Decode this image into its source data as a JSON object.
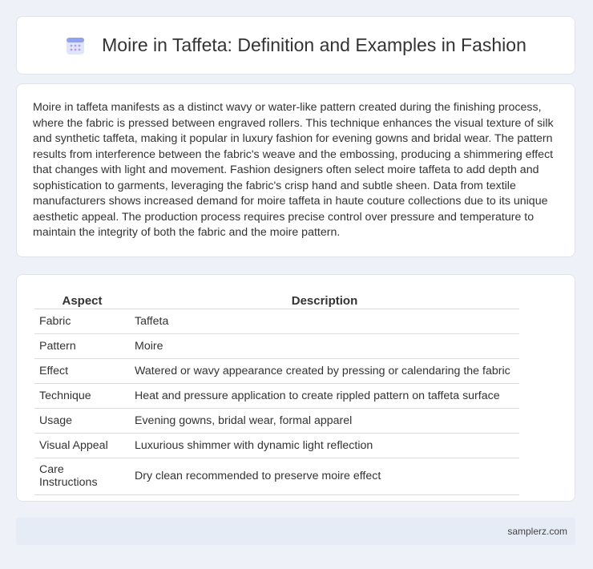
{
  "header": {
    "title": "Moire in Taffeta: Definition and Examples in Fashion",
    "icon": "calendar-icon"
  },
  "intro": {
    "text": "Moire in taffeta manifests as a distinct wavy or water-like pattern created during the finishing process, where the fabric is pressed between engraved rollers. This technique enhances the visual texture of silk and synthetic taffeta, making it popular in luxury fashion for evening gowns and bridal wear. The pattern results from interference between the fabric's weave and the embossing, producing a shimmering effect that changes with light and movement. Fashion designers often select moire taffeta to add depth and sophistication to garments, leveraging the fabric's crisp hand and subtle sheen. Data from textile manufacturers shows increased demand for moire taffeta in haute couture collections due to its unique aesthetic appeal. The production process requires precise control over pressure and temperature to maintain the integrity of both the fabric and the moire pattern."
  },
  "table": {
    "headers": [
      "Aspect",
      "Description"
    ],
    "rows": [
      [
        "Fabric",
        "Taffeta"
      ],
      [
        "Pattern",
        "Moire"
      ],
      [
        "Effect",
        "Watered or wavy appearance created by pressing or calendaring the fabric"
      ],
      [
        "Technique",
        "Heat and pressure application to create rippled pattern on taffeta surface"
      ],
      [
        "Usage",
        "Evening gowns, bridal wear, formal apparel"
      ],
      [
        "Visual Appeal",
        "Luxurious shimmer with dynamic light reflection"
      ],
      [
        "Care Instructions",
        "Dry clean recommended to preserve moire effect"
      ]
    ]
  },
  "footer": {
    "text": "samplerz.com"
  }
}
